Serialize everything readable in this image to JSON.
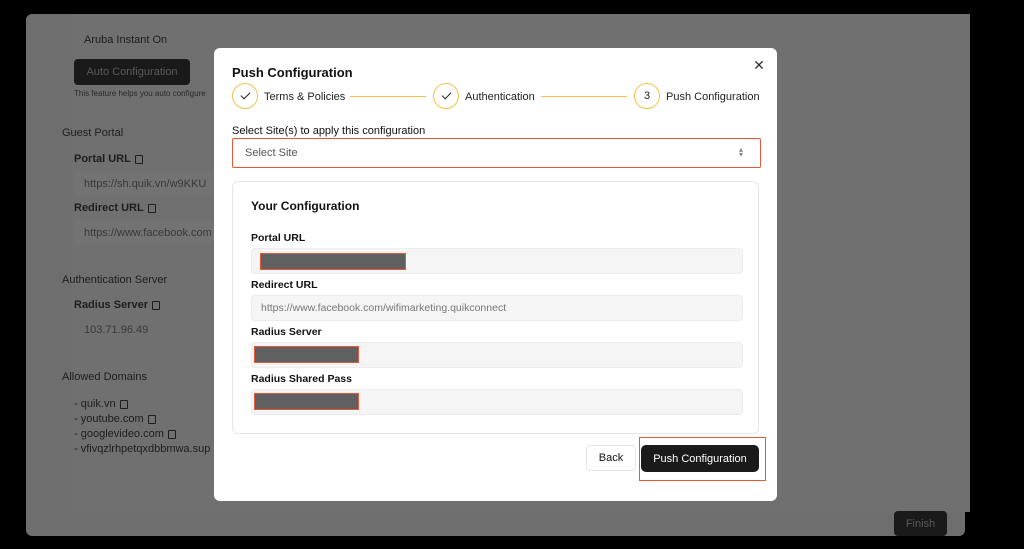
{
  "background": {
    "top_partial_text": "Aruba Instant On",
    "select_value": "Aruba Instant On",
    "auto_config_button": "Auto Configuration",
    "helper_text": "This feature helps you auto configure",
    "guest_portal_heading": "Guest Portal",
    "portal_url_label": "Portal URL",
    "portal_url_value": "https://sh.quik.vn/w9KKU",
    "redirect_url_label": "Redirect URL",
    "redirect_url_value": "https://www.facebook.com",
    "auth_server_heading": "Authentication Server",
    "radius_server_label": "Radius Server",
    "radius_server_value": "103.71.96.49",
    "allowed_domains_heading": "Allowed Domains",
    "domains": [
      "- quik.vn",
      "- youtube.com",
      "- googlevideo.com",
      "- vfivqzlrhpetqxdbbmwa.sup"
    ],
    "finish_button": "Finish"
  },
  "modal": {
    "title": "Push Configuration",
    "steps": [
      {
        "label": "Terms & Policies",
        "state": "done"
      },
      {
        "label": "Authentication",
        "state": "done"
      },
      {
        "label": "Push Configuration",
        "state": "current",
        "number": "3"
      }
    ],
    "site_select": {
      "label": "Select Site(s) to apply this configuration",
      "placeholder": "Select Site"
    },
    "config": {
      "title": "Your Configuration",
      "portal_url_label": "Portal URL",
      "redirect_url_label": "Redirect URL",
      "redirect_url_value": "https://www.facebook.com/wifimarketing.quikconnect",
      "radius_server_label": "Radius Server",
      "radius_pass_label": "Radius Shared Pass"
    },
    "back_button": "Back",
    "push_button": "Push Configuration",
    "close_symbol": "✕"
  },
  "colors": {
    "accent_step": "#f0c24b",
    "highlight": "#e05a3a",
    "primary_button": "#1a1a1a"
  }
}
